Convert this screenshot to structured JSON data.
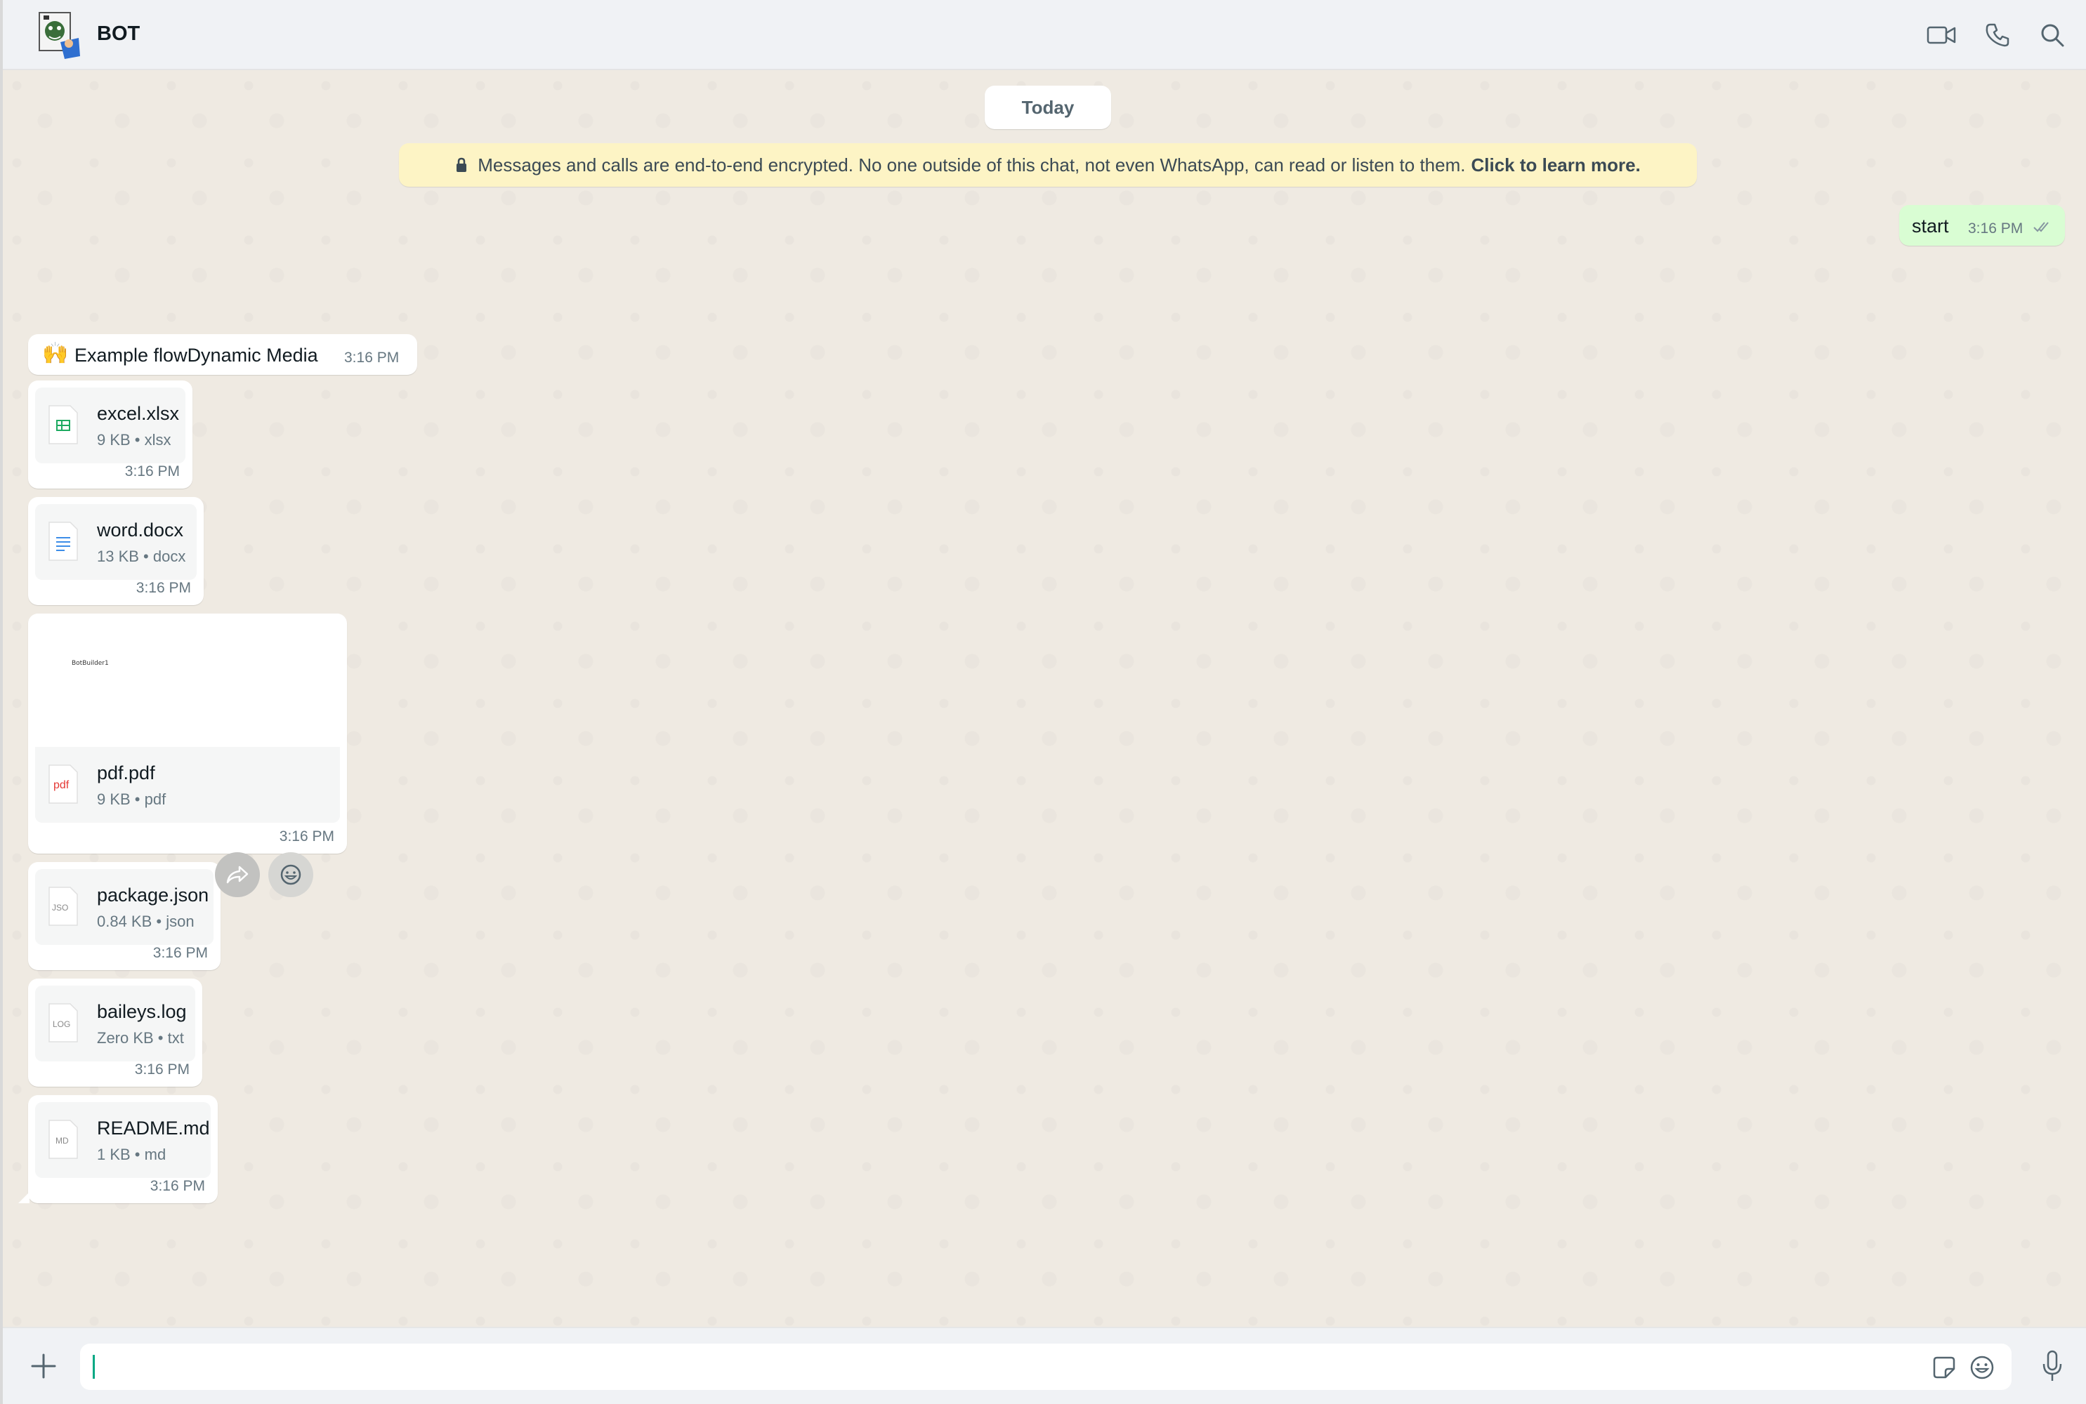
{
  "header": {
    "title": "BOT"
  },
  "chat": {
    "date_chip": "Today",
    "encryption": {
      "text": "Messages and calls are end-to-end encrypted. No one outside of this chat, not even WhatsApp, can read or listen to them.",
      "link": "Click to learn more."
    },
    "outgoing": {
      "text": "start",
      "time": "3:16 PM"
    },
    "incoming_text": {
      "emoji": "🙌",
      "text": "Example flowDynamic Media",
      "time": "3:16 PM"
    },
    "documents": [
      {
        "name": "excel.xlsx",
        "meta": "9 KB • xlsx",
        "time": "3:16 PM",
        "icon": "spreadsheet-icon"
      },
      {
        "name": "word.docx",
        "meta": "13 KB • docx",
        "time": "3:16 PM",
        "icon": "document-icon"
      },
      {
        "name": "pdf.pdf",
        "meta": "9 KB • pdf",
        "time": "3:16 PM",
        "icon": "pdf-icon",
        "icon_label": "pdf",
        "preview_text": "BotBuilder1"
      },
      {
        "name": "package.json",
        "meta": "0.84 KB • json",
        "time": "3:16 PM",
        "icon": "json-file-icon",
        "icon_label": "JSO"
      },
      {
        "name": "baileys.log",
        "meta": "Zero KB • txt",
        "time": "3:16 PM",
        "icon": "log-file-icon",
        "icon_label": "LOG"
      },
      {
        "name": "README.md",
        "meta": "1 KB • md",
        "time": "3:16 PM",
        "icon": "md-file-icon",
        "icon_label": "MD"
      }
    ]
  },
  "composer": {
    "value": "",
    "placeholder": ""
  },
  "colors": {
    "chat_background": "#efeae2",
    "outgoing_bubble": "#d9fdd3",
    "incoming_bubble": "#ffffff",
    "encryption_banner": "#fdf4c5",
    "accent": "#00a884",
    "read_ticks": "#8696a0"
  }
}
